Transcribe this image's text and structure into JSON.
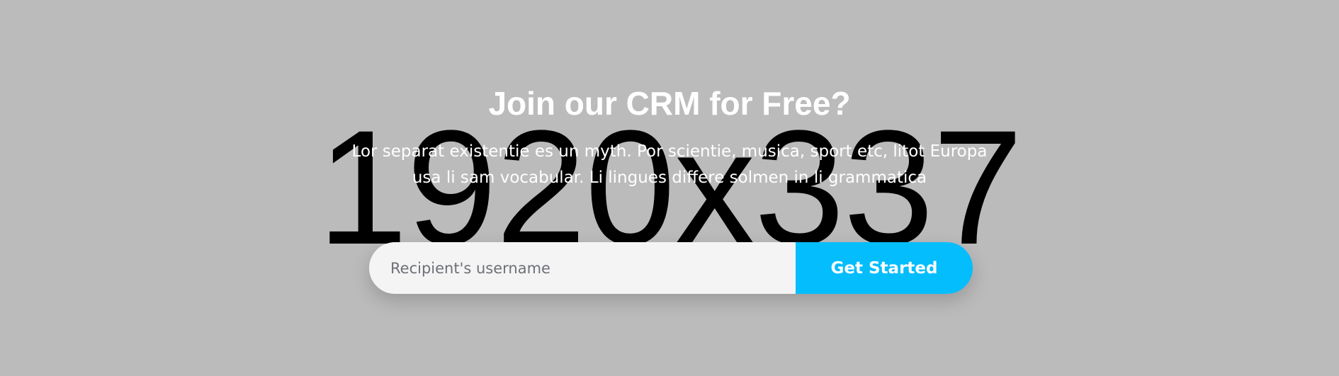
{
  "hero": {
    "background_color": "#bbbbbb",
    "placeholder_image_text": "1920x337",
    "title": "Join our CRM for Free?",
    "subtitle": "Lor separat existentie es un myth. Por scientie, musica, sport etc, litot Europa usa li sam vocabular. Li lingues differe solmen in li grammatica"
  },
  "signup_form": {
    "input_placeholder": "Recipient's username",
    "input_value": "",
    "button_label": "Get Started",
    "button_color": "#04bdfc"
  }
}
